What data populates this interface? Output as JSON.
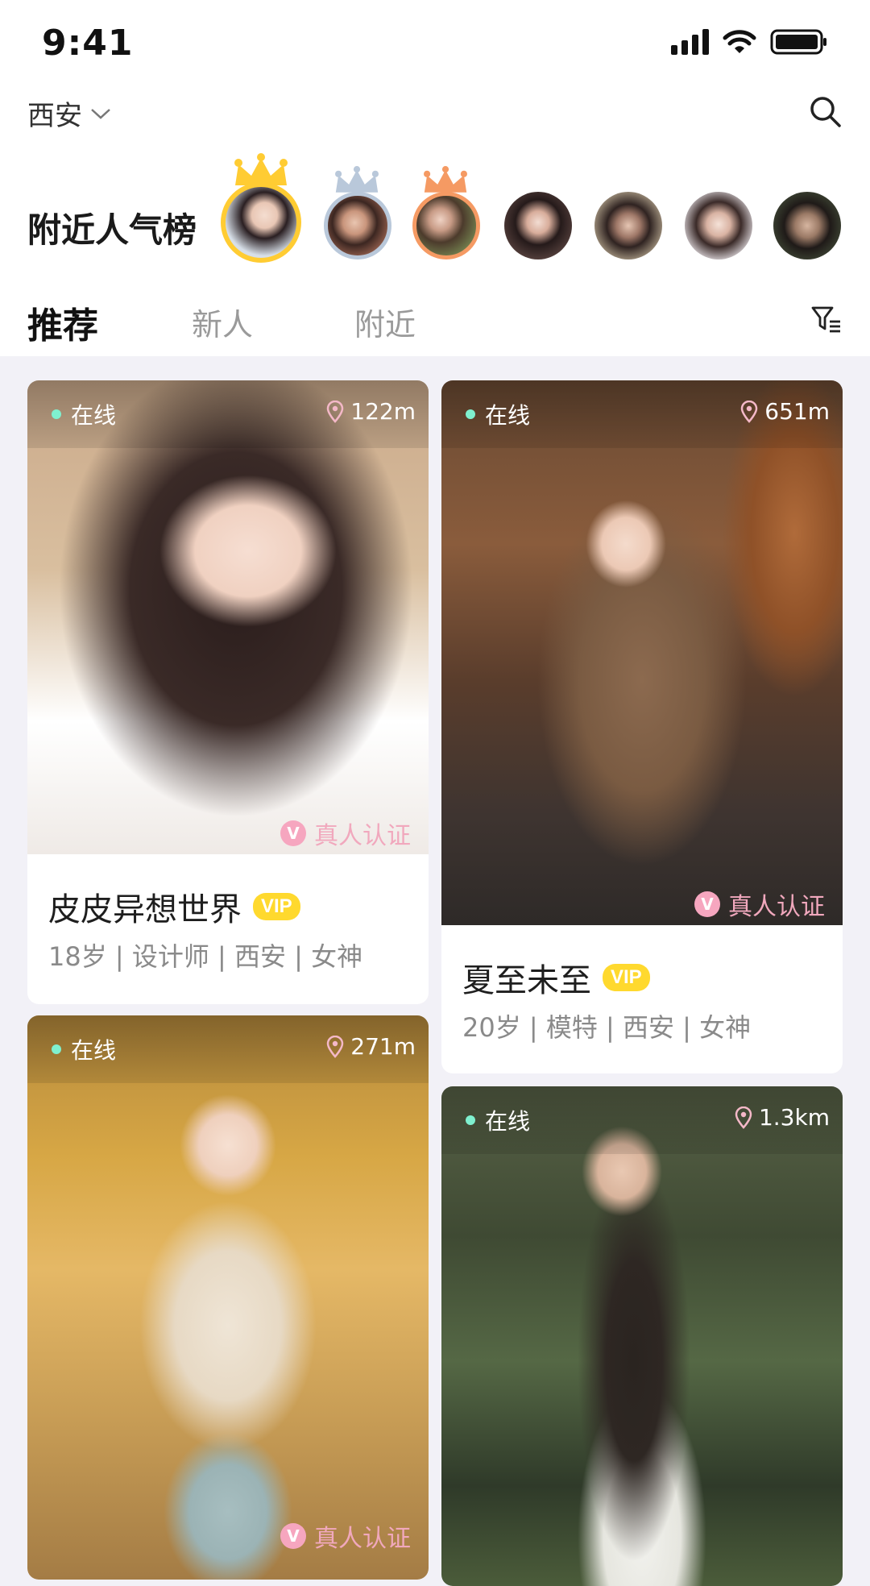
{
  "status_bar": {
    "time": "9:41"
  },
  "header": {
    "city": "西安",
    "rank_title": "附近人气榜"
  },
  "tabs": [
    {
      "label": "推荐",
      "active": true
    },
    {
      "label": "新人",
      "active": false
    },
    {
      "label": "附近",
      "active": false
    }
  ],
  "colors": {
    "gold": "#ffcc33",
    "silver": "#b9c8da",
    "bronze": "#f59a63",
    "online_dot": "#7ff0cf",
    "vip": "#ffd92e",
    "verify_pink": "#f1a8bd"
  },
  "cards": [
    {
      "status": "在线",
      "distance": "122m",
      "verify": "真人认证",
      "name": "皮皮异想世界",
      "vip": "VIP",
      "meta": "18岁 | 设计师 |  西安 | 女神"
    },
    {
      "status": "在线",
      "distance": "651m",
      "verify": "真人认证",
      "name": "夏至未至",
      "vip": "VIP",
      "meta": "20岁 | 模特 |  西安 | 女神"
    },
    {
      "status": "在线",
      "distance": "271m",
      "verify": "真人认证"
    },
    {
      "status": "在线",
      "distance": "1.3km"
    }
  ]
}
